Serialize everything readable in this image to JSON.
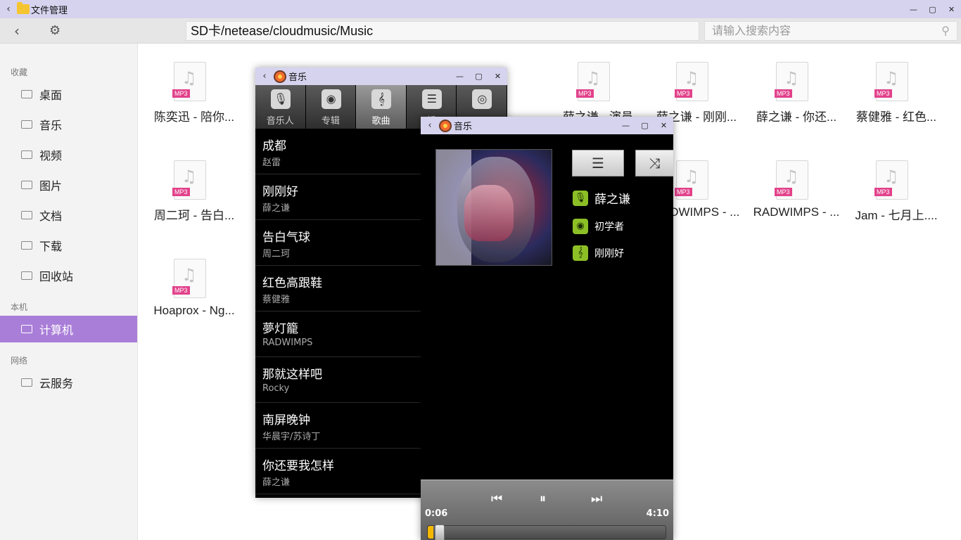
{
  "file_manager": {
    "title": "文件管理",
    "path": "SD卡/netease/cloudmusic/Music",
    "search_placeholder": "请输入搜索内容",
    "sidebar": {
      "sections": {
        "favorites": "收藏",
        "local": "本机",
        "network": "网络"
      },
      "items": [
        "桌面",
        "音乐",
        "视频",
        "图片",
        "文档",
        "下载",
        "回收站",
        "计算机",
        "云服务"
      ],
      "active": "计算机"
    },
    "badge": "MP3",
    "files": [
      "陈奕迅 - 陪你...",
      "薛之谦 - 演员",
      "薛之谦 - 刚刚...",
      "薛之谦 - 你还...",
      "蔡健雅 - 红色...",
      "周二珂 - 告白...",
      "RADWIMPS - ...",
      "RADWIMPS - ...",
      "Jam - 七月上....",
      "Hoaprox - Ng..."
    ]
  },
  "music_window": {
    "title": "音乐",
    "tabs": [
      "音乐人",
      "专辑",
      "歌曲",
      "播"
    ],
    "active_tab": "歌曲",
    "songs": [
      {
        "title": "成都",
        "artist": "赵雷"
      },
      {
        "title": "刚刚好",
        "artist": "薛之谦"
      },
      {
        "title": "告白气球",
        "artist": "周二珂"
      },
      {
        "title": "红色高跟鞋",
        "artist": "蔡健雅"
      },
      {
        "title": "夢灯籠",
        "artist": "RADWIMPS"
      },
      {
        "title": "那就这样吧",
        "artist": "Rocky"
      },
      {
        "title": "南屏晚钟",
        "artist": "华晨宇/苏诗丁"
      },
      {
        "title": "你还要我怎样",
        "artist": "薛之谦"
      }
    ]
  },
  "now_playing": {
    "title": "音乐",
    "artist": "薛之谦",
    "album": "初学者",
    "song": "刚刚好",
    "elapsed": "0:06",
    "duration": "4:10",
    "progress": 0.024
  }
}
